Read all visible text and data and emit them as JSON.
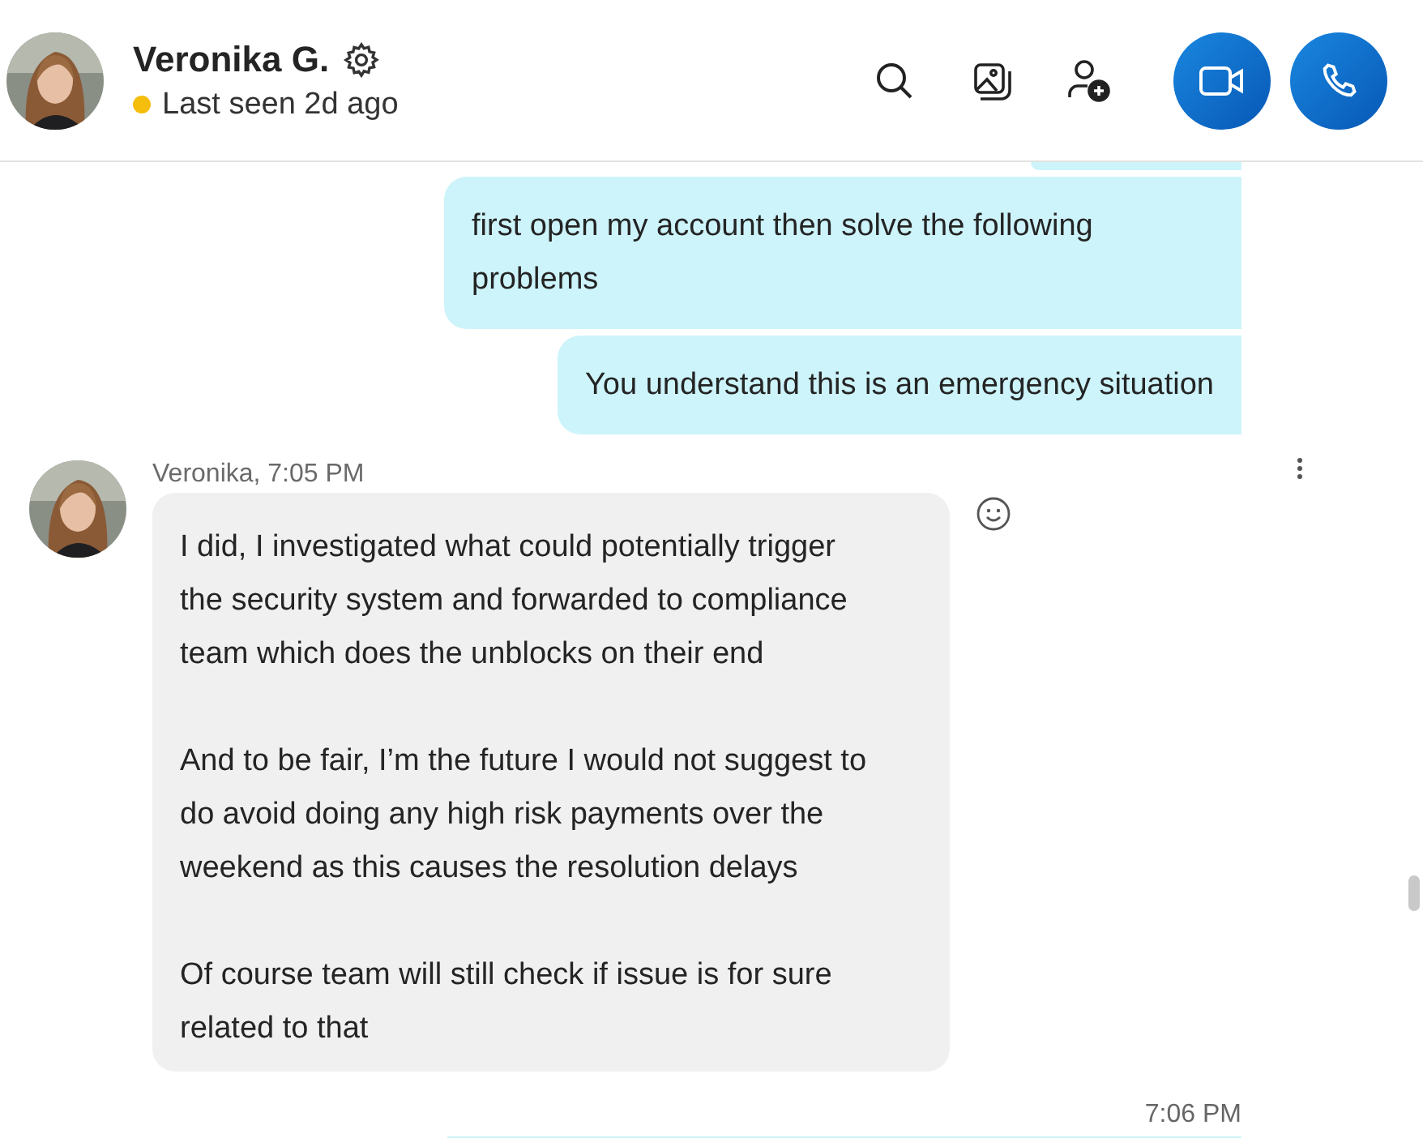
{
  "header": {
    "name": "Veronika G.",
    "status": {
      "text": "Last seen 2d ago",
      "color": "#f5bd0c"
    }
  },
  "messages": [
    {
      "kind": "cut"
    },
    {
      "kind": "outgoing",
      "paragraphs": [
        "first open my account then solve the following problems"
      ]
    },
    {
      "kind": "outgoing",
      "paragraphs": [
        "You understand this is an emergency situation"
      ]
    },
    {
      "kind": "incoming",
      "sender": "Veronika, 7:05 PM",
      "paragraphs": [
        "I did, I investigated what could potentially trigger the security system and forwarded to compliance team which does the unblocks on their end",
        "And to be fair, I’m the future I would not suggest to do avoid doing any high risk payments over the weekend as this causes the resolution delays",
        "Of course team will still check if issue is for sure related to that"
      ]
    },
    {
      "kind": "time",
      "text": "7:06 PM"
    },
    {
      "kind": "cut"
    }
  ]
}
